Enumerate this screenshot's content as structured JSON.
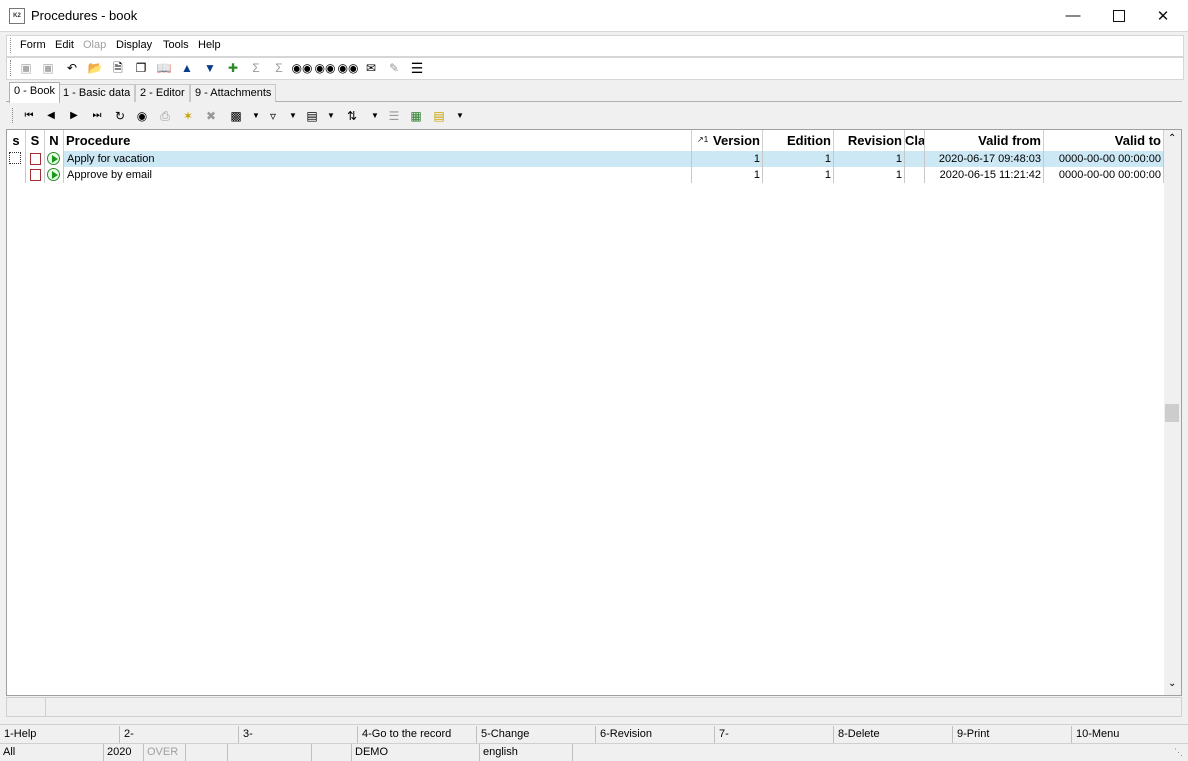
{
  "window": {
    "title": "Procedures - book",
    "icon_label": "K2"
  },
  "menu": [
    "Form",
    "Edit",
    "Olap",
    "Display",
    "Tools",
    "Help"
  ],
  "menu_disabled": [
    "Olap"
  ],
  "tabs": [
    "0 - Book",
    "1 - Basic data",
    "2 - Editor",
    "9 - Attachments"
  ],
  "active_tab": "0 - Book",
  "grid": {
    "columns": {
      "s": "s",
      "S": "S",
      "N": "N",
      "procedure": "Procedure",
      "sort_marker": "↗1",
      "version": "Version",
      "edition": "Edition",
      "revision": "Revision",
      "cla": "Cla",
      "valid_from": "Valid from",
      "valid_to": "Valid to"
    },
    "rows": [
      {
        "procedure": "Apply for vacation",
        "version": "1",
        "edition": "1",
        "revision": "1",
        "cla": "",
        "valid_from": "2020-06-17 09:48:03",
        "valid_to": "0000-00-00 00:00:00",
        "selected": true
      },
      {
        "procedure": "Approve by email",
        "version": "1",
        "edition": "1",
        "revision": "1",
        "cla": "",
        "valid_from": "2020-06-15 11:21:42",
        "valid_to": "0000-00-00 00:00:00",
        "selected": false
      }
    ]
  },
  "function_keys": [
    "1-Help",
    "2-",
    "3-",
    "4-Go to the record",
    "5-Change",
    "6-Revision",
    "7-",
    "8-Delete",
    "9-Print",
    "10-Menu"
  ],
  "status": {
    "filter": "All",
    "year": "2020",
    "mode": "OVER",
    "db": "DEMO",
    "language": "english"
  },
  "colors": {
    "selected_row": "#cce8f4",
    "accent_blue": "#0a3c8c"
  }
}
